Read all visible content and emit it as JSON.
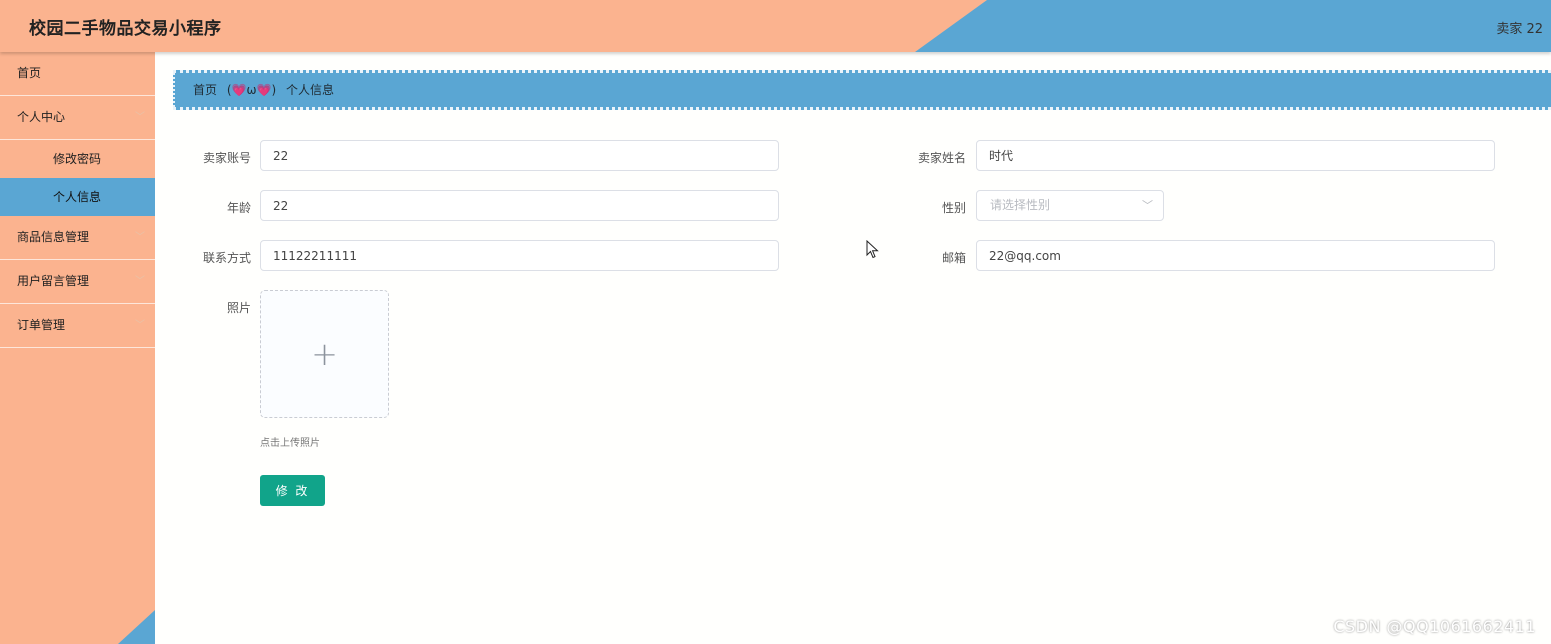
{
  "header": {
    "title": "校园二手物品交易小程序",
    "user": "卖家 22"
  },
  "sidebar": {
    "items": [
      {
        "label": "首页",
        "expandable": false
      },
      {
        "label": "个人中心",
        "expandable": true,
        "children": [
          {
            "label": "修改密码",
            "active": false
          },
          {
            "label": "个人信息",
            "active": true
          }
        ]
      },
      {
        "label": "商品信息管理",
        "expandable": true
      },
      {
        "label": "用户留言管理",
        "expandable": true
      },
      {
        "label": "订单管理",
        "expandable": true
      }
    ]
  },
  "breadcrumb": {
    "home": "首页",
    "separator": "(💗ω💗)",
    "current": "个人信息"
  },
  "form": {
    "account_label": "卖家账号",
    "account_value": "22",
    "name_label": "卖家姓名",
    "name_value": "时代",
    "age_label": "年龄",
    "age_value": "22",
    "gender_label": "性别",
    "gender_placeholder": "请选择性别",
    "contact_label": "联系方式",
    "contact_value": "11122211111",
    "email_label": "邮箱",
    "email_value": "22@qq.com",
    "photo_label": "照片",
    "upload_tip": "点击上传照片",
    "submit_label": "修 改"
  },
  "watermark": "CSDN @QQ1061662411",
  "colors": {
    "sidebar_bg": "#fbb38f",
    "accent_blue": "#5aa6d3",
    "submit_green": "#11a48a"
  }
}
